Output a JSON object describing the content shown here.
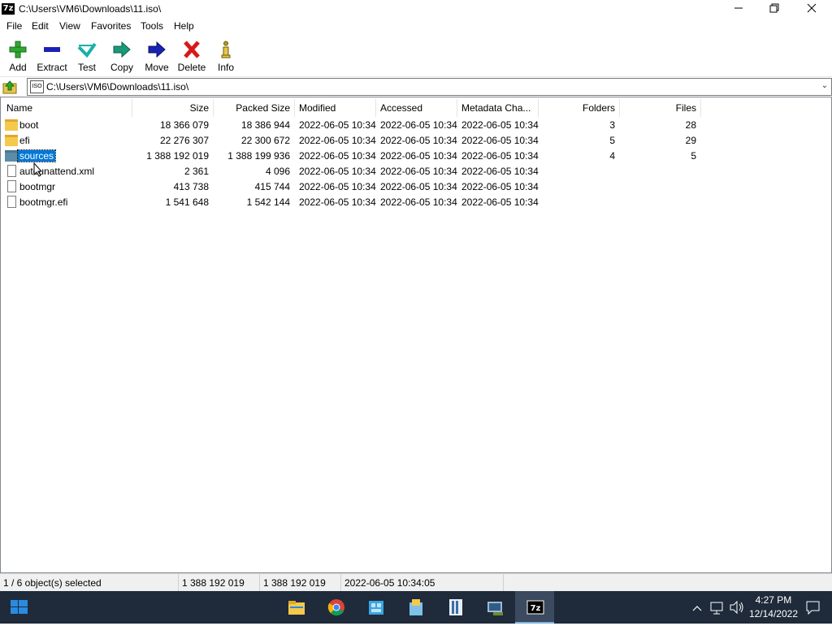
{
  "window": {
    "title": "C:\\Users\\VM6\\Downloads\\11.iso\\",
    "app_icon": "7z"
  },
  "menu": [
    "File",
    "Edit",
    "View",
    "Favorites",
    "Tools",
    "Help"
  ],
  "toolbar": [
    {
      "label": "Add",
      "icon": "add-icon"
    },
    {
      "label": "Extract",
      "icon": "extract-icon"
    },
    {
      "label": "Test",
      "icon": "test-icon"
    },
    {
      "label": "Copy",
      "icon": "copy-icon"
    },
    {
      "label": "Move",
      "icon": "move-icon"
    },
    {
      "label": "Delete",
      "icon": "delete-icon"
    },
    {
      "label": "Info",
      "icon": "info-icon"
    }
  ],
  "address": {
    "icon_text": "ISO",
    "path": "C:\\Users\\VM6\\Downloads\\11.iso\\"
  },
  "columns": [
    "Name",
    "Size",
    "Packed Size",
    "Modified",
    "Accessed",
    "Metadata Cha...",
    "Folders",
    "Files"
  ],
  "rows": [
    {
      "name": "boot",
      "type": "folder",
      "size": "18 366 079",
      "packed": "18 386 944",
      "modified": "2022-06-05 10:34",
      "accessed": "2022-06-05 10:34",
      "meta": "2022-06-05 10:34",
      "folders": "3",
      "files": "28"
    },
    {
      "name": "efi",
      "type": "folder",
      "size": "22 276 307",
      "packed": "22 300 672",
      "modified": "2022-06-05 10:34",
      "accessed": "2022-06-05 10:34",
      "meta": "2022-06-05 10:34",
      "folders": "5",
      "files": "29"
    },
    {
      "name": "sources",
      "type": "folder",
      "selected": true,
      "size": "1 388 192 019",
      "packed": "1 388 199 936",
      "modified": "2022-06-05 10:34",
      "accessed": "2022-06-05 10:34",
      "meta": "2022-06-05 10:34",
      "folders": "4",
      "files": "5"
    },
    {
      "name": "autounattend.xml",
      "type": "file",
      "size": "2 361",
      "packed": "4 096",
      "modified": "2022-06-05 10:34",
      "accessed": "2022-06-05 10:34",
      "meta": "2022-06-05 10:34",
      "folders": "",
      "files": ""
    },
    {
      "name": "bootmgr",
      "type": "file",
      "size": "413 738",
      "packed": "415 744",
      "modified": "2022-06-05 10:34",
      "accessed": "2022-06-05 10:34",
      "meta": "2022-06-05 10:34",
      "folders": "",
      "files": ""
    },
    {
      "name": "bootmgr.efi",
      "type": "file",
      "size": "1 541 648",
      "packed": "1 542 144",
      "modified": "2022-06-05 10:34",
      "accessed": "2022-06-05 10:34",
      "meta": "2022-06-05 10:34",
      "folders": "",
      "files": ""
    }
  ],
  "status": {
    "selection": "1 / 6 object(s) selected",
    "size": "1 388 192 019",
    "packed": "1 388 192 019",
    "modified": "2022-06-05 10:34:05"
  },
  "taskbar": {
    "apps": [
      "file-explorer-icon",
      "chrome-icon",
      "app-icon-1",
      "app-icon-2",
      "app-icon-3",
      "app-icon-4",
      "7zip-icon"
    ],
    "time": "4:27 PM",
    "date": "12/14/2022"
  },
  "colors": {
    "selection": "#0078d7",
    "taskbar": "#1f2a3a",
    "folder": "#f4c94c"
  }
}
